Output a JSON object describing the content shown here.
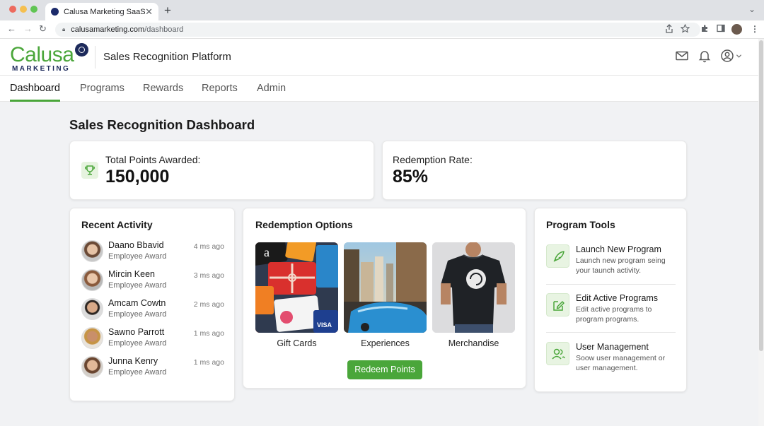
{
  "browser": {
    "tab_title": "Calusa Marketing SaaS",
    "url_host": "calusamarketing.com",
    "url_path": "/dashboard"
  },
  "header": {
    "logo_text": "Calusa",
    "logo_sub": "MARKETING",
    "platform_title": "Sales Recognition Platform"
  },
  "nav": {
    "items": [
      "Dashboard",
      "Programs",
      "Rewards",
      "Reports",
      "Admin"
    ],
    "active": "Dashboard"
  },
  "page": {
    "title": "Sales Recognition Dashboard"
  },
  "stats": {
    "total_points_label": "Total Points Awarded:",
    "total_points_value": "150,000",
    "redemption_label": "Redemption Rate:",
    "redemption_value": "85%"
  },
  "recent_activity": {
    "title": "Recent Activity",
    "items": [
      {
        "name": "Daano Bbavid",
        "type": "Employee Award",
        "time": "4 ms ago"
      },
      {
        "name": "Mircin Keen",
        "type": "Employee Award",
        "time": "3 ms ago"
      },
      {
        "name": "Amcam Cowtn",
        "type": "Employee Award",
        "time": "2 ms ago"
      },
      {
        "name": "Sawno Parrott",
        "type": "Employee Award",
        "time": "1 ms ago"
      },
      {
        "name": "Junna Kenry",
        "type": "Employee Award",
        "time": "1 ms ago"
      }
    ]
  },
  "redemption": {
    "title": "Redemption Options",
    "options": [
      "Gift Cards",
      "Experiences",
      "Merchandise"
    ],
    "button": "Redeem Points"
  },
  "tools": {
    "title": "Program Tools",
    "items": [
      {
        "title": "Launch New Program",
        "desc": "Launch new program seing your taunch activity.",
        "icon": "rocket-icon"
      },
      {
        "title": "Edit Active Programs",
        "desc": "Edit active programs to program programs.",
        "icon": "edit-icon"
      },
      {
        "title": "User Management",
        "desc": "Soow user management or user management.",
        "icon": "users-icon"
      }
    ]
  },
  "colors": {
    "accent": "#4aa63a",
    "brand_navy": "#1d2a5b"
  }
}
